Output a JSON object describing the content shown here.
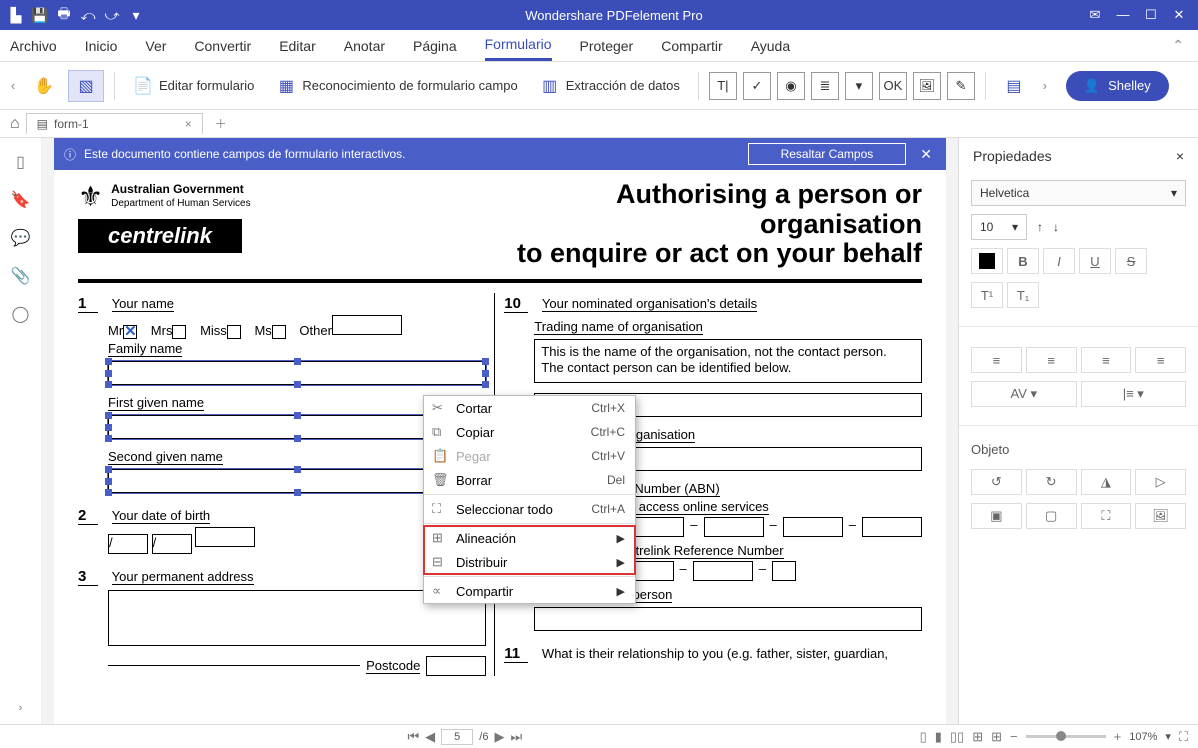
{
  "titlebar": {
    "title": "Wondershare PDFelement Pro"
  },
  "menubar": {
    "items": [
      "Archivo",
      "Inicio",
      "Ver",
      "Convertir",
      "Editar",
      "Anotar",
      "Página",
      "Formulario",
      "Proteger",
      "Compartir",
      "Ayuda"
    ],
    "active": 7
  },
  "toolbar": {
    "edit_form": "Editar formulario",
    "recognize": "Reconocimiento de formulario campo",
    "extract": "Extracción de datos",
    "user": "Shelley"
  },
  "tabbar": {
    "tab_name": "form-1"
  },
  "banner": {
    "message": "Este documento contiene campos de formulario interactivos.",
    "highlight": "Resaltar Campos"
  },
  "doc": {
    "gov1": "Australian Government",
    "gov2": "Department of Human Services",
    "centrelink": "centrelink",
    "title_l1": "Authorising a person or organisation",
    "title_l2": "to enquire or act on your behalf",
    "q1": {
      "num": "1",
      "label": "Your name",
      "mr": "Mr",
      "mrs": "Mrs",
      "miss": "Miss",
      "ms": "Ms",
      "other": "Other",
      "family": "Family name",
      "first": "First given name",
      "second": "Second given name"
    },
    "q2": {
      "num": "2",
      "label": "Your date of birth"
    },
    "q3": {
      "num": "3",
      "label": "Your permanent address",
      "postcode": "Postcode"
    },
    "q10": {
      "num": "10",
      "label": "Your nominated organisation's details",
      "trade": "Trading name of organisation",
      "note1": "This is the name of the organisation, not the contact person.",
      "note2": "The contact person can be identified below.",
      "addr": "organisation",
      "abn": "s Number (ABN)",
      "crn_pre": "to access online services",
      "crn": "Organisation Centrelink Reference Number",
      "contact": "Name of contact person"
    },
    "q11": {
      "num": "11",
      "label": "What is their relationship to you (e.g. father, sister, guardian,"
    }
  },
  "context": {
    "cut": "Cortar",
    "cut_sc": "Ctrl+X",
    "copy": "Copiar",
    "copy_sc": "Ctrl+C",
    "paste": "Pegar",
    "paste_sc": "Ctrl+V",
    "delete": "Borrar",
    "delete_sc": "Del",
    "select_all": "Seleccionar todo",
    "select_all_sc": "Ctrl+A",
    "align": "Alineación",
    "distribute": "Distribuir",
    "share": "Compartir"
  },
  "props": {
    "title": "Propiedades",
    "font": "Helvetica",
    "size": "10",
    "object": "Objeto"
  },
  "status": {
    "current": "5",
    "total": "/6",
    "zoom": "107%"
  }
}
